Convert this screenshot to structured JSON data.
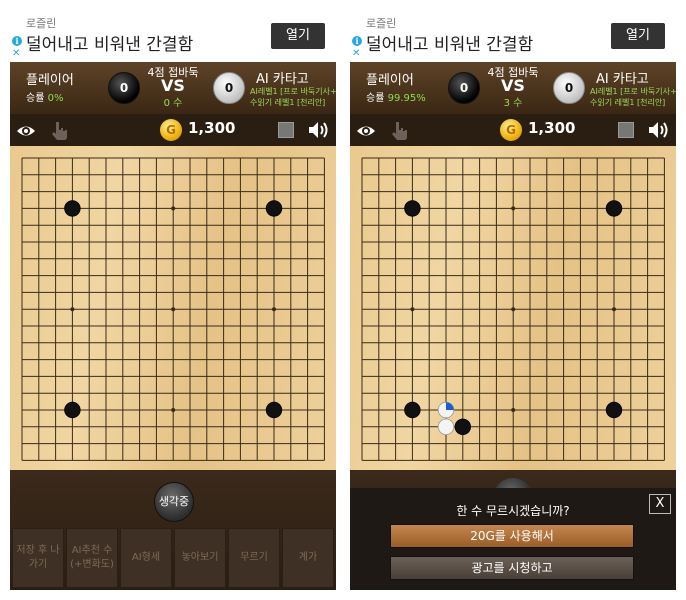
{
  "left": {
    "ad": {
      "sponsor": "로즐린",
      "text": "덜어내고 비워낸 간결함",
      "button": "열기"
    },
    "header": {
      "player_name": "플레이어",
      "player_rate_label": "승률",
      "player_rate_value": "0%",
      "player_captures": "0",
      "game_mode": "4점 접바둑",
      "vs": "VS",
      "moves": "0 수",
      "ai_name": "AI 카타고",
      "ai_captures": "0",
      "ai_level": "AI레벨1 [프로 바둑기사+]",
      "ai_read": "수읽기 레벨1 [천리안]"
    },
    "toolbar": {
      "coins": "1,300",
      "coin_glyph": "G"
    },
    "board": {
      "size": 19,
      "stones": [
        {
          "color": "black",
          "col": 3,
          "row": 3
        },
        {
          "color": "black",
          "col": 15,
          "row": 3
        },
        {
          "color": "black",
          "col": 3,
          "row": 15
        },
        {
          "color": "black",
          "col": 15,
          "row": 15
        }
      ]
    },
    "think_button": "생각중",
    "actions": [
      {
        "label": "저장 후 나가기"
      },
      {
        "label": "AI추천 수 (+변화도)"
      },
      {
        "label": "AI형세"
      },
      {
        "label": "놓아보기"
      },
      {
        "label": "무르기"
      },
      {
        "label": "계가"
      }
    ]
  },
  "right": {
    "ad": {
      "sponsor": "로즐린",
      "text": "덜어내고 비워낸 간결함",
      "button": "열기"
    },
    "header": {
      "player_name": "플레이어",
      "player_rate_label": "승률",
      "player_rate_value": "99.95%",
      "player_captures": "0",
      "game_mode": "4점 접바둑",
      "vs": "VS",
      "moves": "3 수",
      "ai_name": "AI 카타고",
      "ai_captures": "0",
      "ai_level": "AI레벨1 [프로 바둑기사+]",
      "ai_read": "수읽기 레벨1 [천리안]"
    },
    "toolbar": {
      "coins": "1,300",
      "coin_glyph": "G"
    },
    "board": {
      "size": 19,
      "stones": [
        {
          "color": "black",
          "col": 3,
          "row": 3
        },
        {
          "color": "black",
          "col": 15,
          "row": 3
        },
        {
          "color": "black",
          "col": 3,
          "row": 15
        },
        {
          "color": "black",
          "col": 15,
          "row": 15
        },
        {
          "color": "white",
          "col": 5,
          "row": 15,
          "last": true
        },
        {
          "color": "white",
          "col": 5,
          "row": 16
        },
        {
          "color": "black",
          "col": 6,
          "row": 16
        }
      ]
    },
    "dialog": {
      "title": "한 수 무르시겠습니까?",
      "close": "X",
      "pay_button": "20G를 사용해서",
      "ad_button": "광고를 시청하고"
    }
  }
}
